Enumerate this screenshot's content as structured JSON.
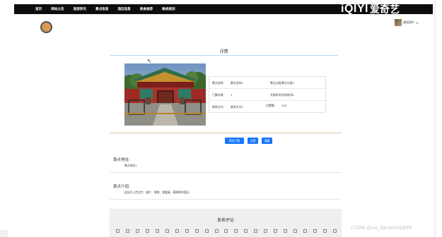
{
  "nav": {
    "items": [
      "首页",
      "网站公告",
      "旅游资讯",
      "景点信息",
      "酒店信息",
      "美食推荐",
      "路线规划"
    ]
  },
  "brand": {
    "logo_text": "iQIYI",
    "cn_text": "爱奇艺"
  },
  "user": {
    "name": "测试用户"
  },
  "detail": {
    "title": "详情",
    "rows": [
      [
        {
          "label": "景点名称:",
          "value": "景点名称1"
        },
        {
          "label": "景点分类:",
          "value": "景点分类1"
        }
      ],
      [
        {
          "label": "门票价格:",
          "value": "1"
        },
        {
          "label": "开放时间:",
          "value": "开放时间1"
        }
      ],
      [
        {
          "label": "联系方式:",
          "value": "联系方式1"
        },
        {
          "label": "点赞数:",
          "value": "154"
        }
      ]
    ]
  },
  "buttons": {
    "buy": "预定门票",
    "like": "点赞",
    "fav": "收藏"
  },
  "address": {
    "heading": "景点地址:",
    "value": "景点地址1"
  },
  "intro": {
    "heading": "景点介绍:",
    "value": "此处可上传文字、图片、视频、超链接、表情等内容区!"
  },
  "comment": {
    "title": "发表评论"
  },
  "watermark": "CSDN @vx_danpianji889",
  "colors": {
    "nav_bg": "#0d0d0d",
    "button": "#1677ff",
    "avatar_ring": "#d79b55",
    "comment_bg": "#efefef"
  }
}
